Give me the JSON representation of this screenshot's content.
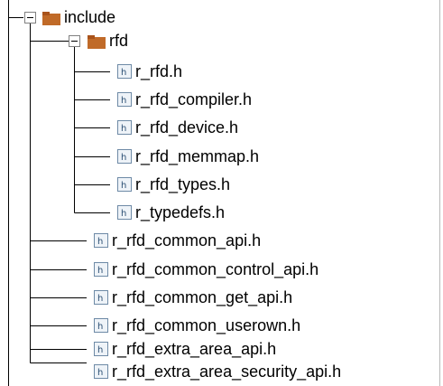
{
  "tree": {
    "nodes": [
      {
        "label": "include",
        "icon": "folder-icon",
        "expanded": true
      },
      {
        "label": "rfd",
        "icon": "folder-icon",
        "expanded": true
      },
      {
        "label": "r_rfd.h",
        "icon": "header-file-icon"
      },
      {
        "label": "r_rfd_compiler.h",
        "icon": "header-file-icon"
      },
      {
        "label": "r_rfd_device.h",
        "icon": "header-file-icon"
      },
      {
        "label": "r_rfd_memmap.h",
        "icon": "header-file-icon"
      },
      {
        "label": "r_rfd_types.h",
        "icon": "header-file-icon"
      },
      {
        "label": "r_typedefs.h",
        "icon": "header-file-icon"
      },
      {
        "label": "r_rfd_common_api.h",
        "icon": "header-file-icon"
      },
      {
        "label": "r_rfd_common_control_api.h",
        "icon": "header-file-icon"
      },
      {
        "label": "r_rfd_common_get_api.h",
        "icon": "header-file-icon"
      },
      {
        "label": "r_rfd_common_userown.h",
        "icon": "header-file-icon"
      },
      {
        "label": "r_rfd_extra_area_api.h",
        "icon": "header-file-icon"
      },
      {
        "label": "r_rfd_extra_area_security_api.h",
        "icon": "header-file-icon"
      }
    ]
  },
  "colors": {
    "folder": "#c06a28",
    "line": "#000000",
    "file_border": "#6e8aa6"
  }
}
